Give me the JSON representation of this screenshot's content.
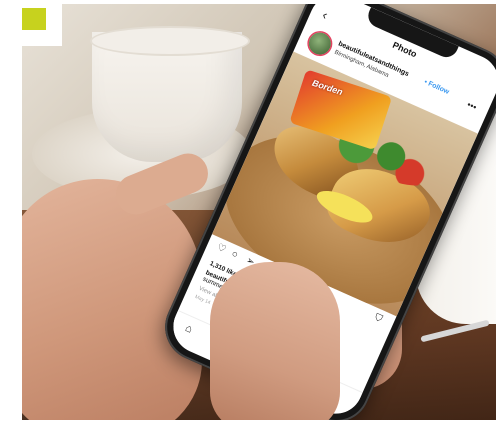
{
  "accent_color": "#c7d21e",
  "app": {
    "screen_title": "Photo",
    "back_icon": "‹",
    "more_icon": "•••",
    "post": {
      "username": "beautifuleatsandthings",
      "follow_label": "• Follow",
      "location": "Birmingham, Alabama",
      "bag_brand": "Borden",
      "likes": "1,310 likes",
      "caption_user": "beautifuleatsandthings",
      "caption_text": "summer is the cookout",
      "comments_link": "View all 9 comments",
      "time_ago": "May 14"
    },
    "icons": {
      "like": "heart-icon",
      "comment": "comment-icon",
      "share": "send-icon",
      "save": "bookmark-icon",
      "home": "home-icon",
      "search": "search-icon",
      "add": "add-post-icon",
      "activity": "heart-outline-icon"
    }
  }
}
